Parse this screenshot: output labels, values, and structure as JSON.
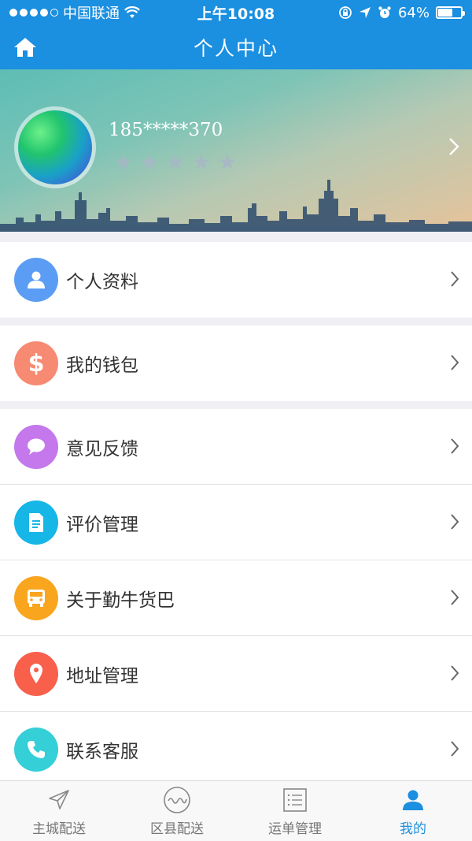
{
  "status_bar": {
    "carrier": "中国联通",
    "time": "上午10:08",
    "battery": "64%",
    "battery_level": 0.64
  },
  "nav": {
    "title": "个人中心"
  },
  "profile": {
    "phone": "185*****370",
    "rating_stars": 5,
    "rating_filled": 0
  },
  "menu": [
    {
      "label": "个人资料",
      "icon": "person-icon",
      "color": "#5b9df5"
    },
    {
      "label": "我的钱包",
      "icon": "dollar-icon",
      "color": "#f78a72"
    },
    {
      "label": "意见反馈",
      "icon": "chat-bubble-icon",
      "color": "#c478ec"
    },
    {
      "label": "评价管理",
      "icon": "document-icon",
      "color": "#16b6e6"
    },
    {
      "label": "关于勤牛货巴",
      "icon": "bus-icon",
      "color": "#f9a51e"
    },
    {
      "label": "地址管理",
      "icon": "location-pin-icon",
      "color": "#f8604c"
    },
    {
      "label": "联系客服",
      "icon": "phone-icon",
      "color": "#35cfd8"
    }
  ],
  "tabs": [
    {
      "label": "主城配送",
      "icon": "paper-plane-icon",
      "active": false
    },
    {
      "label": "区县配送",
      "icon": "wave-circle-icon",
      "active": false
    },
    {
      "label": "运单管理",
      "icon": "list-icon",
      "active": false
    },
    {
      "label": "我的",
      "icon": "user-icon",
      "active": true
    }
  ],
  "colors": {
    "primary": "#1b8fe0",
    "inactive_tab": "#777777"
  }
}
